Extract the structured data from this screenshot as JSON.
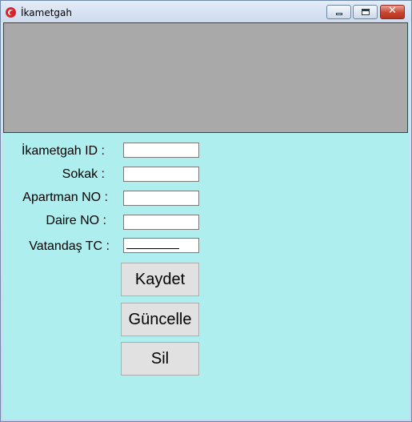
{
  "window": {
    "title": "İkametgah",
    "icon": "turkish-flag-icon",
    "controls": {
      "minimize_icon": "minimize-icon",
      "maximize_icon": "maximize-icon",
      "close_glyph": "✕"
    }
  },
  "colors": {
    "client_background": "#afeeee",
    "panel_background": "#a9a9a9",
    "button_face": "#e1e1e1",
    "close_button": "#c7442f"
  },
  "form": {
    "fields": [
      {
        "label": "İkametgah ID :",
        "value": ""
      },
      {
        "label": "Sokak :",
        "value": ""
      },
      {
        "label": "Apartman NO :",
        "value": ""
      },
      {
        "label": "Daire NO :",
        "value": ""
      },
      {
        "label": "Vatandaş TC :",
        "value": ""
      }
    ]
  },
  "buttons": {
    "save": "Kaydet",
    "update": "Güncelle",
    "delete": "Sil"
  }
}
